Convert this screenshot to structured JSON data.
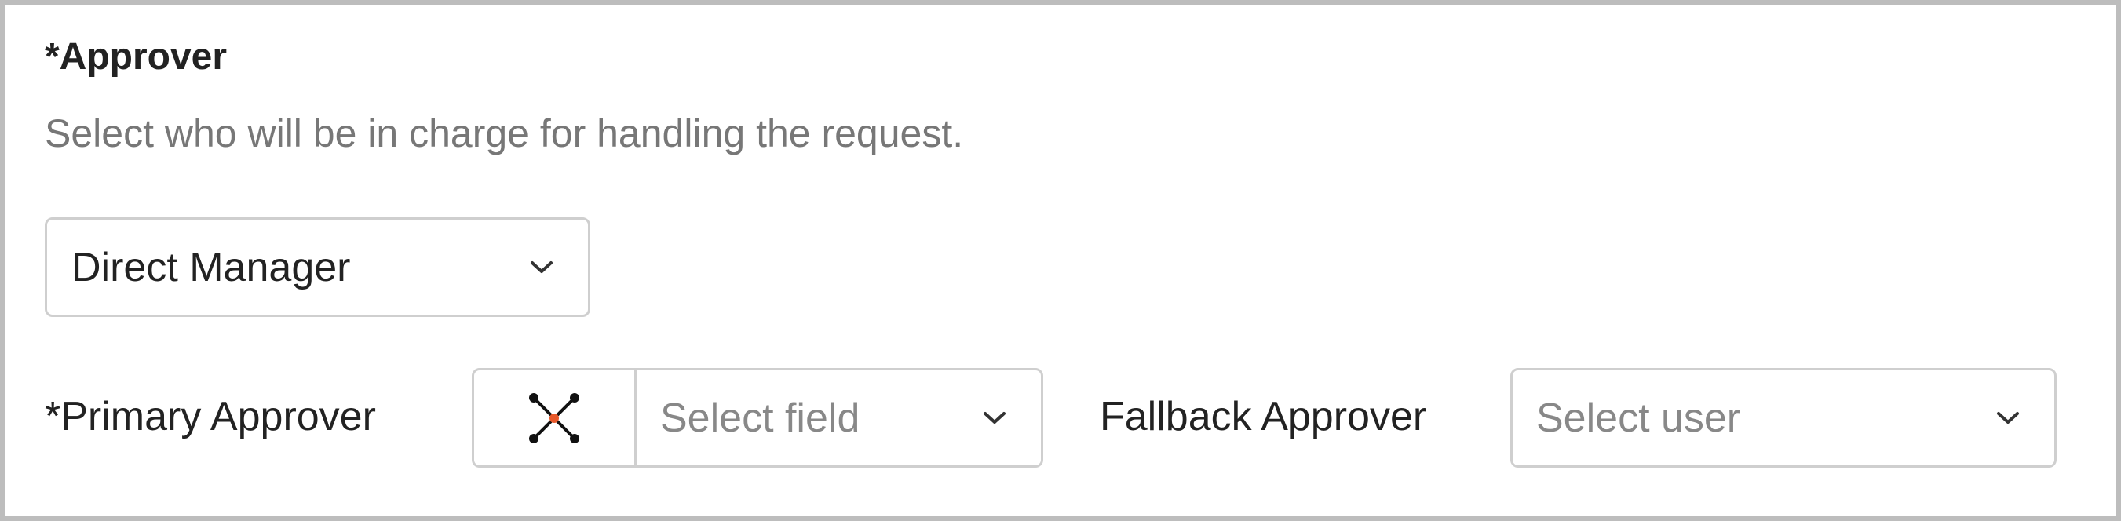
{
  "section": {
    "title": "*Approver",
    "description": "Select who will be in charge for handling the request."
  },
  "approver_type": {
    "selected": "Direct Manager",
    "icon": "chevron-down-icon"
  },
  "primary_approver": {
    "label": "*Primary Approver",
    "field_icon": "workflow-nodes-icon",
    "placeholder": "Select field"
  },
  "fallback_approver": {
    "label": "Fallback Approver",
    "placeholder": "Select user"
  },
  "colors": {
    "border": "#cfcfcf",
    "frame": "#bdbdbd",
    "text": "#222222",
    "muted": "#777777",
    "placeholder": "#888888",
    "accent": "#e8582a"
  }
}
